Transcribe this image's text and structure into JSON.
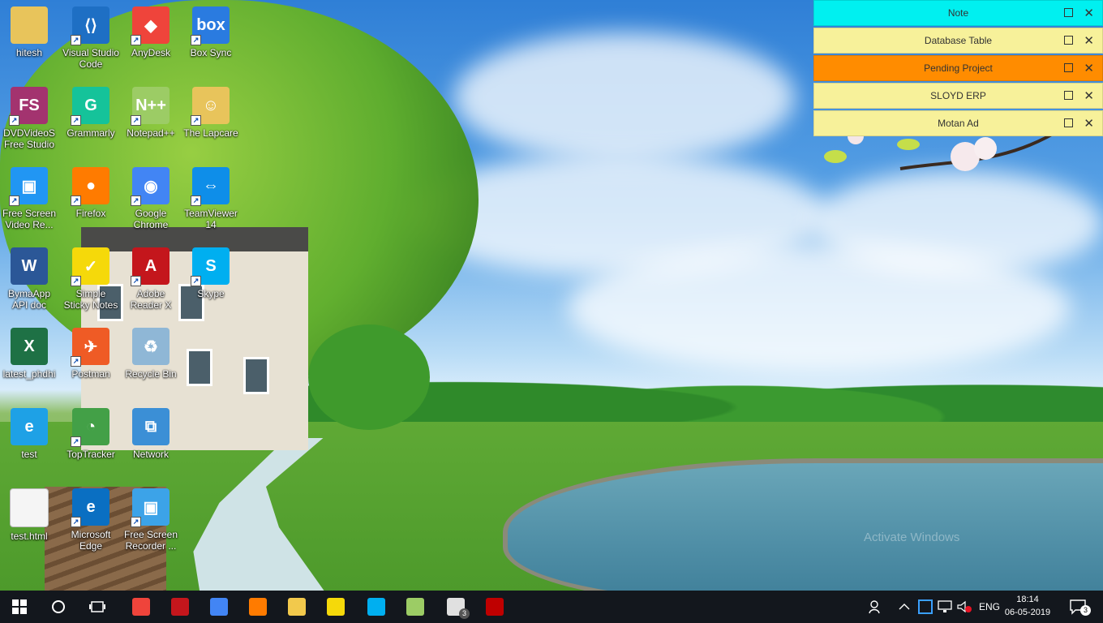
{
  "desktop": {
    "icons": [
      {
        "label": "hitesh",
        "icon": "folder-icon",
        "color": "#e8c45b"
      },
      {
        "label": "Visual Studio Code",
        "icon": "vscode-icon",
        "color": "#1e6fc4"
      },
      {
        "label": "AnyDesk",
        "icon": "anydesk-icon",
        "color": "#ef443b"
      },
      {
        "label": "Box Sync",
        "icon": "box-sync-icon",
        "color": "#2a7be0"
      },
      {
        "label": "DVDVideoS Free Studio",
        "icon": "dvdvideosoft-icon",
        "color": "#a3336f"
      },
      {
        "label": "Grammarly",
        "icon": "grammarly-icon",
        "color": "#15c39a"
      },
      {
        "label": "Notepad++",
        "icon": "notepadpp-icon",
        "color": "#9ccc65"
      },
      {
        "label": "The Lapcare",
        "icon": "folder-user-icon",
        "color": "#e8c45b"
      },
      {
        "label": "Free Screen Video Re...",
        "icon": "screen-recorder-icon",
        "color": "#2196f3"
      },
      {
        "label": "Firefox",
        "icon": "firefox-icon",
        "color": "#ff7b00"
      },
      {
        "label": "Google Chrome",
        "icon": "chrome-icon",
        "color": "#4285f4"
      },
      {
        "label": "TeamViewer 14",
        "icon": "teamviewer-icon",
        "color": "#0e8ee9"
      },
      {
        "label": "BymaApp API doc",
        "icon": "word-doc-icon",
        "color": "#2b5797"
      },
      {
        "label": "Simple Sticky Notes",
        "icon": "sticky-notes-icon",
        "color": "#f5d90a"
      },
      {
        "label": "Adobe Reader X",
        "icon": "adobe-reader-icon",
        "color": "#c4161c"
      },
      {
        "label": "Skype",
        "icon": "skype-icon",
        "color": "#00aff0"
      },
      {
        "label": "latest_phdhi",
        "icon": "excel-doc-icon",
        "color": "#1e7145"
      },
      {
        "label": "Postman",
        "icon": "postman-icon",
        "color": "#ef5b25"
      },
      {
        "label": "Recycle Bin",
        "icon": "recycle-bin-icon",
        "color": "#8fb7d6"
      },
      {
        "label": "test",
        "icon": "internet-explorer-icon",
        "color": "#1ea1e6"
      },
      {
        "label": "TopTracker",
        "icon": "toptracker-icon",
        "color": "#43a047"
      },
      {
        "label": "Network",
        "icon": "network-icon",
        "color": "#3b8fd6"
      },
      {
        "label": "test.html",
        "icon": "blank-file-icon",
        "color": "#f5f5f5"
      },
      {
        "label": "Microsoft Edge",
        "icon": "edge-icon",
        "color": "#0a6fc2"
      },
      {
        "label": "Free Screen Recorder ...",
        "icon": "screen-recorder-icon",
        "color": "#3ca3e8"
      }
    ]
  },
  "sticky_notes": [
    {
      "title": "Note",
      "color": "#00f0f0"
    },
    {
      "title": "Database Table",
      "color": "#f7f19a"
    },
    {
      "title": "Pending Project",
      "color": "#ff8c00"
    },
    {
      "title": "SLOYD ERP",
      "color": "#f7f19a"
    },
    {
      "title": "Motan Ad",
      "color": "#f7f19a"
    }
  ],
  "watermark": "Activate Windows",
  "taskbar": {
    "apps": [
      {
        "name": "anydesk-icon",
        "color": "#ef443b"
      },
      {
        "name": "adobe-reader-icon",
        "color": "#c4161c"
      },
      {
        "name": "chrome-icon",
        "color": "#4285f4"
      },
      {
        "name": "firefox-icon",
        "color": "#ff7b00"
      },
      {
        "name": "file-explorer-icon",
        "color": "#f2c94c"
      },
      {
        "name": "sticky-notes-icon",
        "color": "#f5d90a"
      },
      {
        "name": "skype-icon",
        "color": "#00aff0"
      },
      {
        "name": "notepadpp-icon",
        "color": "#9ccc65"
      },
      {
        "name": "mail-icon",
        "color": "#e0e0e0",
        "badge": "3"
      },
      {
        "name": "filezilla-icon",
        "color": "#bf0000"
      }
    ],
    "tray": {
      "language": "ENG",
      "time": "18:14",
      "date": "06-05-2019",
      "notifications_badge": "3"
    }
  }
}
